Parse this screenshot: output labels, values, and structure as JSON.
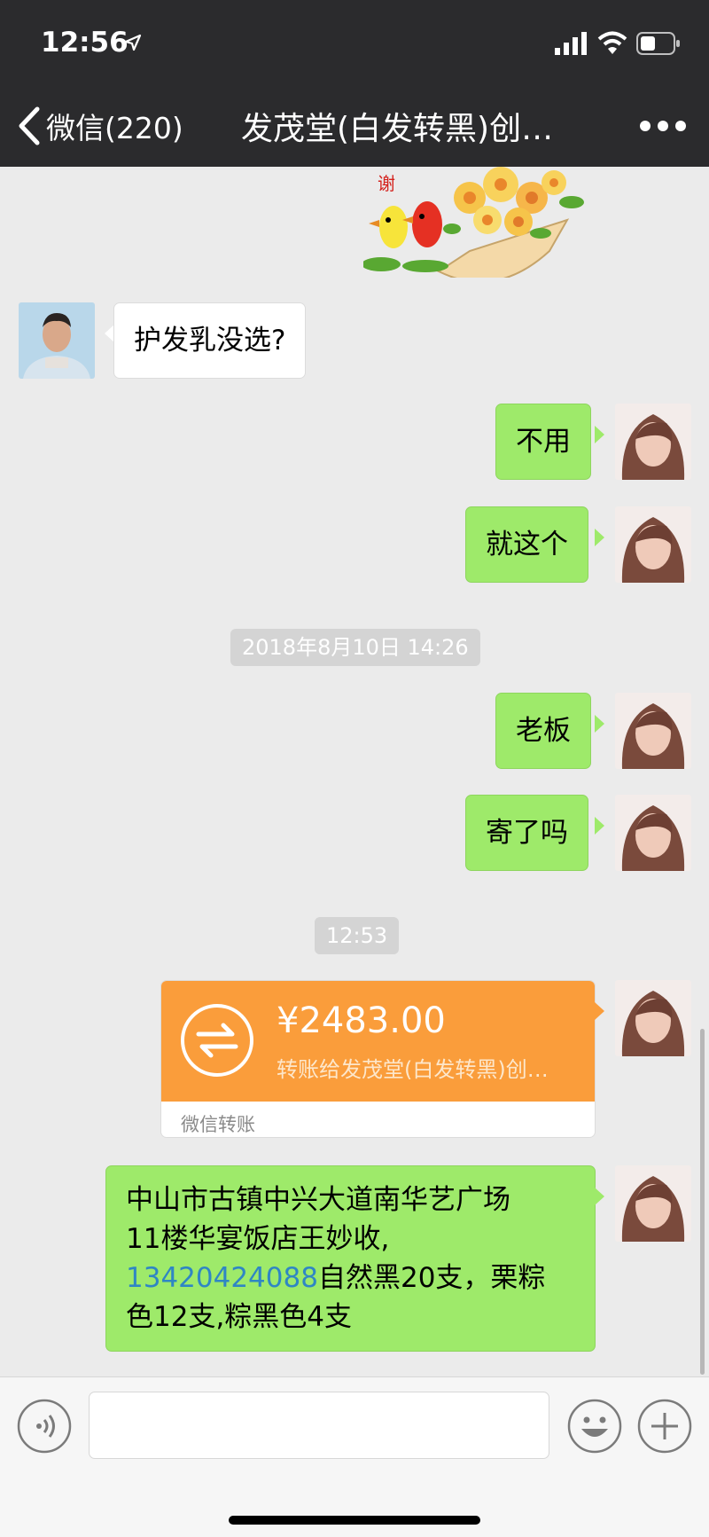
{
  "status_bar": {
    "time": "12:56"
  },
  "nav": {
    "back_label": "微信(220)",
    "title": "发茂堂(白发转黑)创…"
  },
  "messages": {
    "m1": "护发乳没选?",
    "m2": "不用",
    "m3": "就这个",
    "ts1": "2018年8月10日 14:26",
    "m4": "老板",
    "m5": "寄了吗",
    "ts2": "12:53",
    "transfer": {
      "amount": "¥2483.00",
      "description": "转账给发茂堂(白发转黑)创…",
      "footer": "微信转账"
    },
    "address": {
      "line1": "中山市古镇中兴大道南华艺广场",
      "line2": "11楼华宴饭店王妙收,",
      "phone": "13420424088",
      "line3_rest": "自然黑20支，栗粽",
      "line4": "色12支,粽黑色4支"
    }
  },
  "sticker": {
    "text": "谢"
  },
  "colors": {
    "header_bg": "#2b2b2d",
    "chat_bg": "#ebebeb",
    "bubble_green": "#9eea6a",
    "transfer_orange": "#fa9d3b",
    "link_blue": "#2f86c4"
  }
}
